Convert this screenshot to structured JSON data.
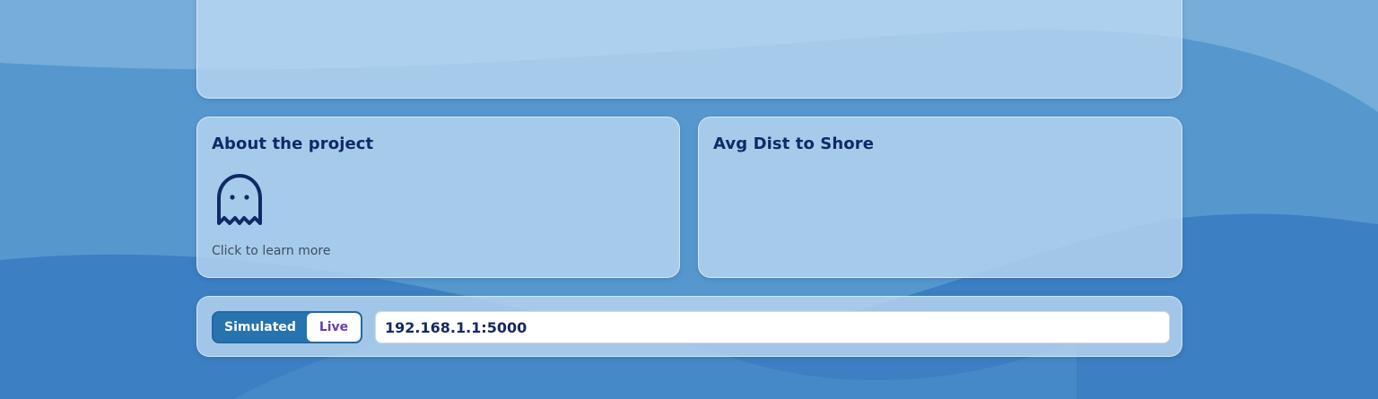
{
  "about_card": {
    "title": "About the project",
    "icon": "ghost-icon",
    "link_text": "Click to learn more"
  },
  "avg_dist_card": {
    "title": "Avg Dist to Shore"
  },
  "connection": {
    "mode_options": [
      "Simulated",
      "Live"
    ],
    "selected_mode": "Live",
    "address_value": "192.168.1.1:5000"
  },
  "colors": {
    "background": "#3f82c4",
    "card": "#b4d4ef",
    "title_text": "#0f2a66",
    "toggle_active": "#2673ad",
    "live_text": "#6a3fb1"
  }
}
